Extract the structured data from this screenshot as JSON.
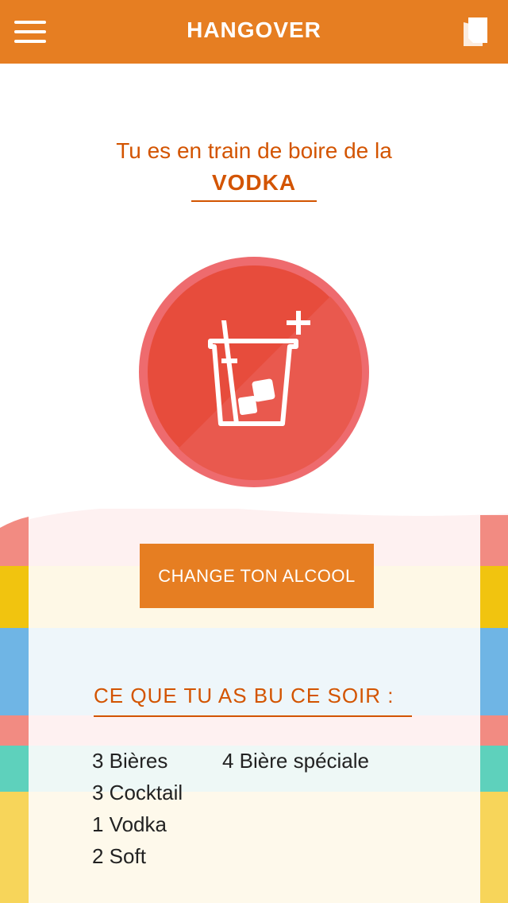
{
  "header": {
    "title": "HANGOVER",
    "menu_icon": "hamburger-menu-icon",
    "copy_icon": "copy-icon"
  },
  "current": {
    "prompt": "Tu es en train de boire de la",
    "drink": "VODKA"
  },
  "add_drink": {
    "icon": "glass-add-icon"
  },
  "change_button": {
    "label": "CHANGE TON ALCOOL"
  },
  "tonight": {
    "title": "CE QUE TU AS BU CE SOIR :",
    "left": [
      "3 Bières",
      "3 Cocktail",
      "1 Vodka",
      "2 Soft"
    ],
    "right": [
      "4 Bière spéciale"
    ]
  },
  "colors": {
    "orange": "#E67E22",
    "text_orange": "#D35400",
    "circle_outer": "#EE6B6E",
    "circle_inner": "#E74C3C"
  }
}
